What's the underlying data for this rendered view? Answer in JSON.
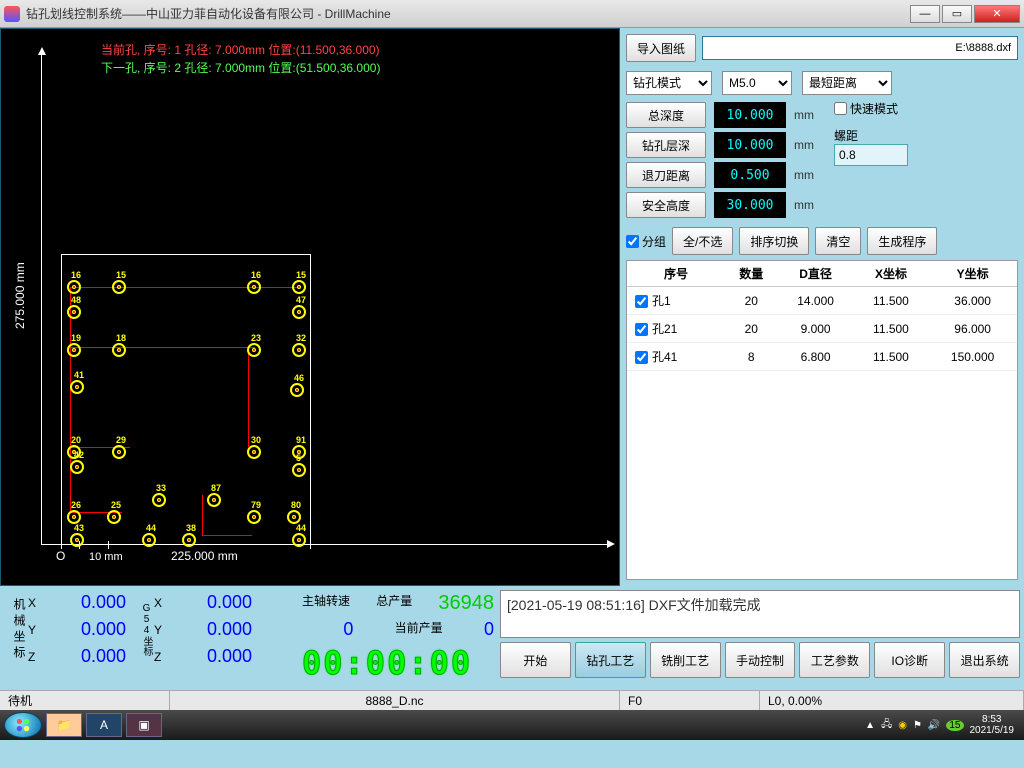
{
  "title": "钻孔划线控制系统——中山亚力菲自动化设备有限公司 - DrillMachine",
  "canvas": {
    "current": "当前孔, 序号: 1 孔径: 7.000mm 位置:(11.500,36.000)",
    "next": "下一孔, 序号: 2 孔径: 7.000mm 位置:(51.500,36.000)",
    "ylabel": "275.000 mm",
    "xlabel": "225.000 mm",
    "origin": "O",
    "scale": "10 mm"
  },
  "right": {
    "import_btn": "导入图纸",
    "filepath": "E:\\8888.dxf",
    "mode": "钻孔模式",
    "tool": "M5.0",
    "sort": "最短距离",
    "params": [
      {
        "label": "总深度",
        "value": "10.000",
        "unit": "mm"
      },
      {
        "label": "钻孔层深",
        "value": "10.000",
        "unit": "mm"
      },
      {
        "label": "退刀距离",
        "value": "0.500",
        "unit": "mm"
      },
      {
        "label": "安全高度",
        "value": "30.000",
        "unit": "mm"
      }
    ],
    "fast_mode": "快速模式",
    "pitch_label": "螺距",
    "pitch_value": "0.8",
    "group_chk": "分组",
    "btn_all": "全/不选",
    "btn_sort": "排序切换",
    "btn_clear": "清空",
    "btn_gen": "生成程序",
    "th": [
      "序号",
      "数量",
      "D直径",
      "X坐标",
      "Y坐标"
    ],
    "rows": [
      {
        "chk": true,
        "id": "孔1",
        "qty": "20",
        "d": "14.000",
        "x": "11.500",
        "y": "36.000"
      },
      {
        "chk": true,
        "id": "孔21",
        "qty": "20",
        "d": "9.000",
        "x": "11.500",
        "y": "96.000"
      },
      {
        "chk": true,
        "id": "孔41",
        "qty": "8",
        "d": "6.800",
        "x": "11.500",
        "y": "150.000"
      }
    ]
  },
  "bottom": {
    "mach": "机\n械\n坐\n标",
    "g54_lbl": "G54\n坐\n标",
    "axes": [
      "X",
      "Y",
      "Z"
    ],
    "mx": "0.000",
    "my": "0.000",
    "mz": "0.000",
    "gx": "0.000",
    "gy": "0.000",
    "gz": "0.000",
    "spindle_lbl": "主轴转速",
    "spindle_val": "",
    "total_lbl": "总产量",
    "total_val": "36948",
    "cur_lbl": "当前产量",
    "cur_val": "0",
    "other_val": "0",
    "clock": "00:00:00",
    "log": "[2021-05-19 08:51:16]  DXF文件加载完成",
    "actions": [
      "开始",
      "钻孔工艺",
      "铣削工艺",
      "手动控制",
      "工艺参数",
      "IO诊断",
      "退出系统"
    ]
  },
  "status": {
    "s1": "待机",
    "s2": "8888_D.nc",
    "s3": "F0",
    "s4": "L0, 0.00%"
  },
  "taskbar": {
    "time": "8:53",
    "date": "2021/5/19"
  }
}
